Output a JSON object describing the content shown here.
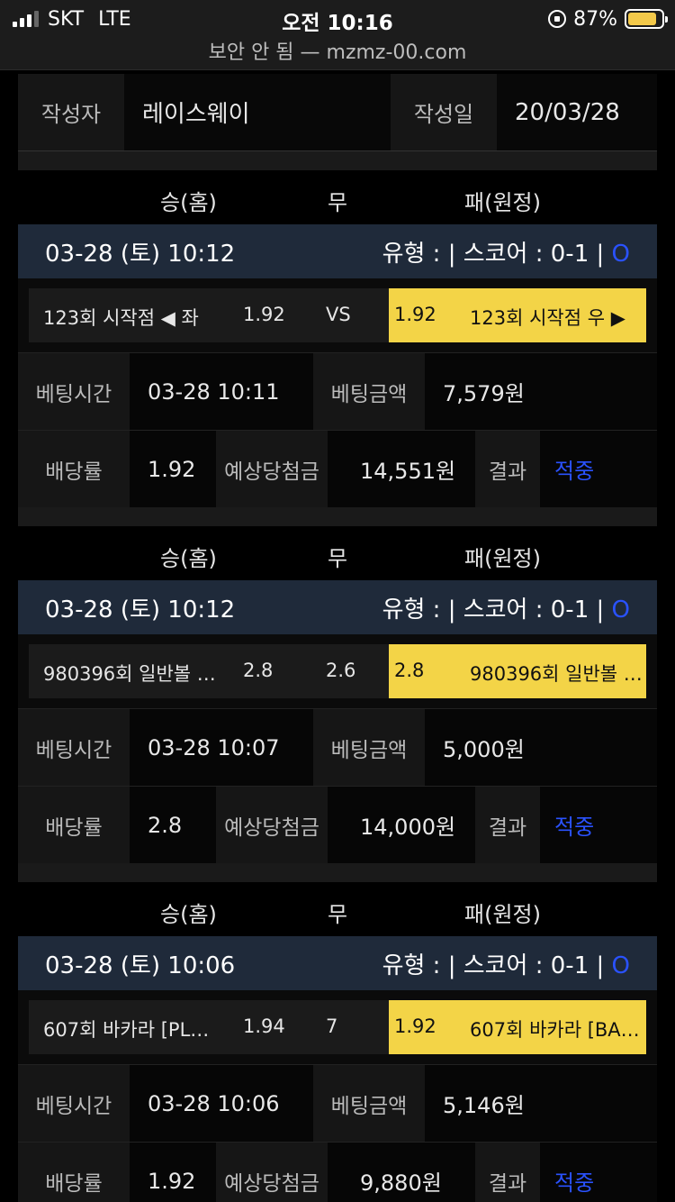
{
  "status": {
    "carrier": "SKT",
    "network": "LTE",
    "time": "오전 10:16",
    "battery": "87%",
    "battery_level": 0.87
  },
  "browser": {
    "url_text": "보안 안 됨 — mzmz-00.com"
  },
  "meta": {
    "author_label": "작성자",
    "author": "레이스웨이",
    "date_label": "작성일",
    "date": "20/03/28"
  },
  "header": {
    "home": "승(홈)",
    "draw": "무",
    "away": "패(원정)"
  },
  "info_labels": {
    "bet_time": "베팅시간",
    "bet_amount": "베팅금액",
    "odds": "배당률",
    "expected": "예상당첨금",
    "result": "결과"
  },
  "colors": {
    "accent_yellow": "#f3d447",
    "date_row_bg": "#1f2a3a",
    "hit_blue": "#2a52ff"
  },
  "bets": [
    {
      "datetime": "03-28 (토) 10:12",
      "type_score": "유형 : | 스코어 : 0-1 |",
      "marker": "O",
      "home_team": "123회 시작점 ◀ 좌",
      "home_odds": "1.92",
      "draw": "VS",
      "away_odds": "1.92",
      "away_team": "123회 시작점 우 ▶",
      "bet_time": "03-28 10:11",
      "bet_amount": "7,579원",
      "odds": "1.92",
      "expected": "14,551원",
      "result": "적중"
    },
    {
      "datetime": "03-28 (토) 10:12",
      "type_score": "유형 : | 스코어 : 0-1 |",
      "marker": "O",
      "home_team": "980396회 일반볼 …",
      "home_odds": "2.8",
      "draw": "2.6",
      "away_odds": "2.8",
      "away_team": "980396회 일반볼 …",
      "bet_time": "03-28 10:07",
      "bet_amount": "5,000원",
      "odds": "2.8",
      "expected": "14,000원",
      "result": "적중"
    },
    {
      "datetime": "03-28 (토) 10:06",
      "type_score": "유형 : | 스코어 : 0-1 |",
      "marker": "O",
      "home_team": "607회 바카라 [PL…",
      "home_odds": "1.94",
      "draw": "7",
      "away_odds": "1.92",
      "away_team": "607회 바카라 [BA…",
      "bet_time": "03-28 10:06",
      "bet_amount": "5,146원",
      "odds": "1.92",
      "expected": "9,880원",
      "result": "적중"
    }
  ]
}
